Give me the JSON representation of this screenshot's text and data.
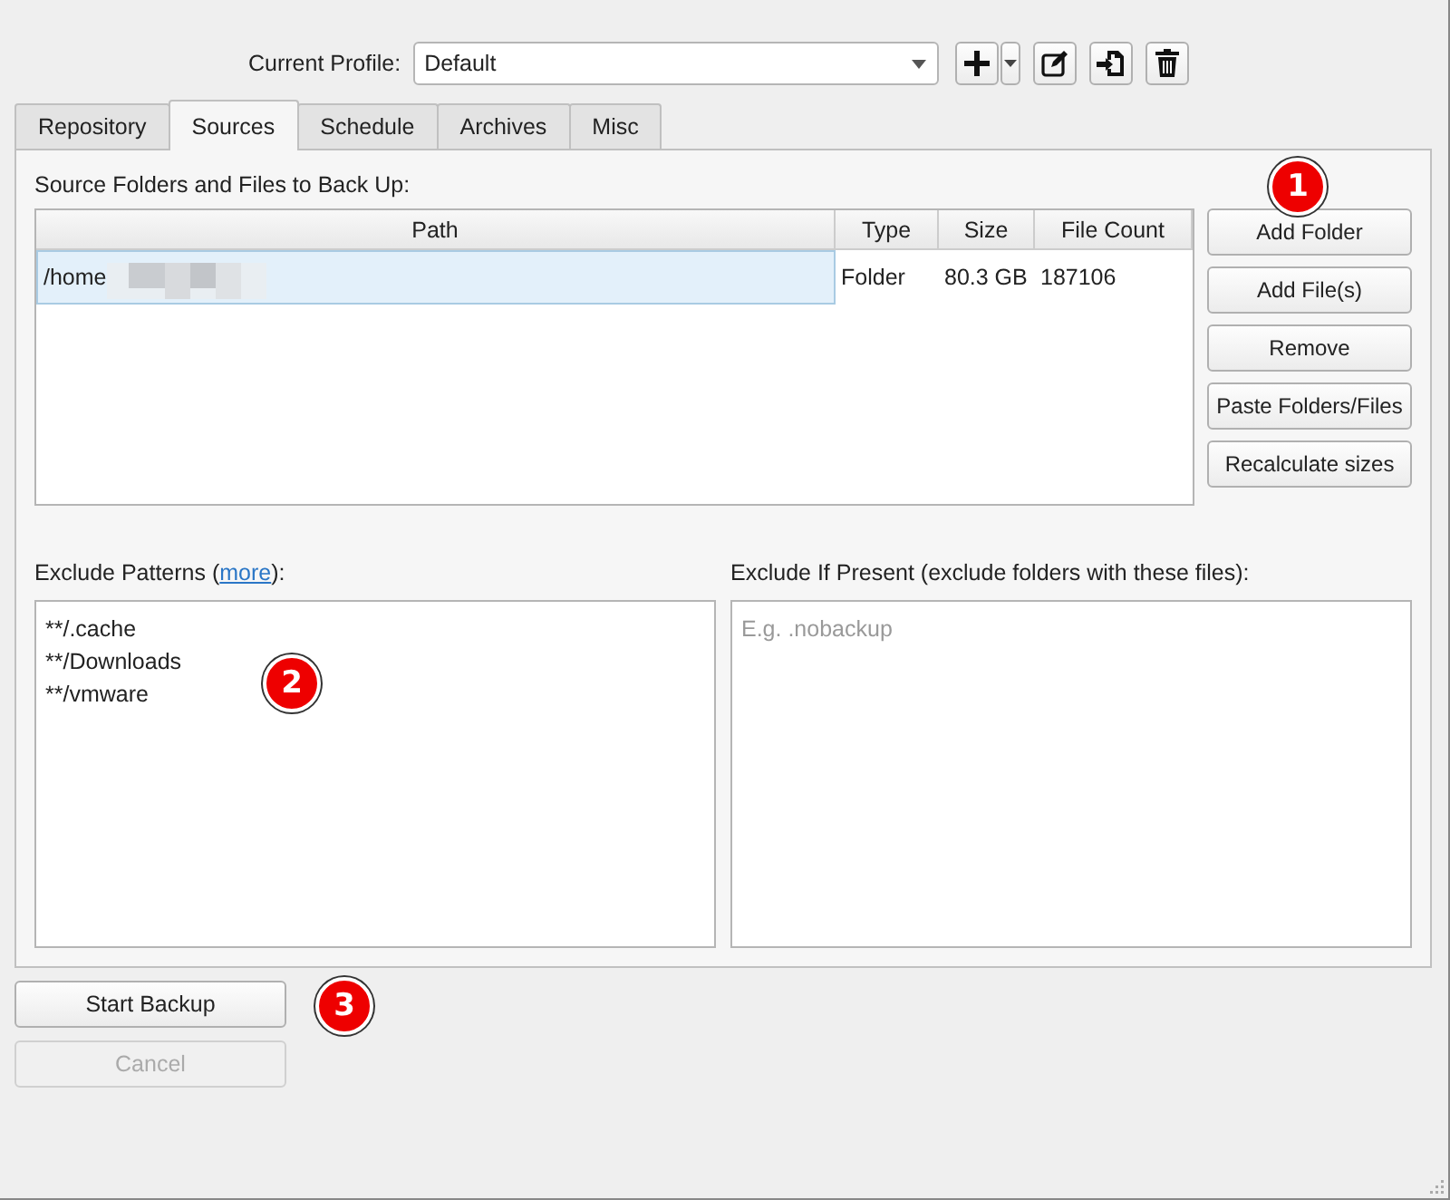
{
  "profile": {
    "label": "Current Profile:",
    "value": "Default"
  },
  "tabs": [
    {
      "label": "Repository",
      "selected": false
    },
    {
      "label": "Sources",
      "selected": true
    },
    {
      "label": "Schedule",
      "selected": false
    },
    {
      "label": "Archives",
      "selected": false
    },
    {
      "label": "Misc",
      "selected": false
    }
  ],
  "sources": {
    "title": "Source Folders and Files to Back Up:",
    "columns": [
      "Path",
      "Type",
      "Size",
      "File Count"
    ],
    "rows": [
      {
        "cells": [
          "/home",
          "Folder",
          "80.3 GB",
          "187106"
        ],
        "selected": true
      }
    ],
    "buttons": [
      "Add Folder",
      "Add File(s)",
      "Remove",
      "Paste Folders/Files",
      "Recalculate sizes"
    ]
  },
  "exclude_patterns": {
    "label_start": "Exclude Patterns (",
    "link": "more",
    "label_end": "):",
    "lines": [
      "**/.cache",
      "**/Downloads",
      "**/vmware"
    ]
  },
  "exclude_if_present": {
    "label": "Exclude If Present (exclude folders with these files):",
    "placeholder": "E.g. .nobackup"
  },
  "actions": [
    {
      "label": "Start Backup",
      "disabled": false
    },
    {
      "label": "Cancel",
      "disabled": true
    }
  ],
  "callouts": [
    "1",
    "2",
    "3"
  ]
}
